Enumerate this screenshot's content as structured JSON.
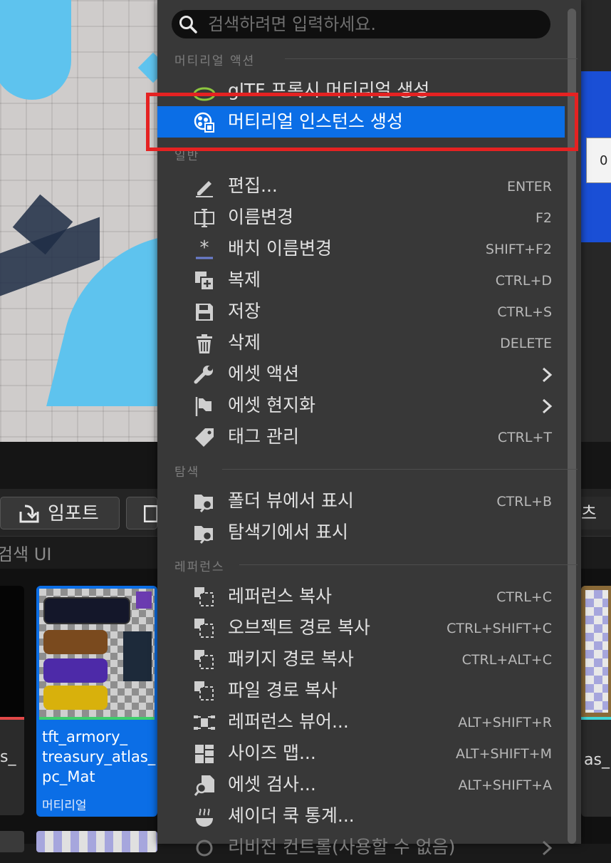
{
  "colors": {
    "menu_bg": "#383838",
    "highlight": "#0b6ee6",
    "annotation_red": "#e52222",
    "viewport_blue": "#5ec3ee"
  },
  "viewport": {
    "popup_text": "0"
  },
  "context_menu": {
    "search": {
      "placeholder": "검색하려면 입력하세요.",
      "icon": "search-icon"
    },
    "sections": {
      "material_actions": "머티리얼 액션",
      "general": "일반",
      "explore": "탐색",
      "references": "레퍼런스"
    },
    "material_items": [
      {
        "label": "glTF 프록시 머티리얼 생성",
        "icon": "gltf-icon"
      },
      {
        "label": "머티리얼 인스턴스 생성",
        "icon": "material-instance-icon",
        "highlighted": true
      }
    ],
    "general_items": [
      {
        "label": "편집...",
        "shortcut": "ENTER",
        "icon": "pencil-icon"
      },
      {
        "label": "이름변경",
        "shortcut": "F2",
        "icon": "rename-icon"
      },
      {
        "label": "배치 이름변경",
        "shortcut": "SHIFT+F2",
        "icon": "batch-rename-icon"
      },
      {
        "label": "복제",
        "shortcut": "CTRL+D",
        "icon": "duplicate-icon"
      },
      {
        "label": "저장",
        "shortcut": "CTRL+S",
        "icon": "save-icon"
      },
      {
        "label": "삭제",
        "shortcut": "DELETE",
        "icon": "trash-icon"
      },
      {
        "label": "에셋 액션",
        "submenu": true,
        "icon": "wrench-icon"
      },
      {
        "label": "에셋 현지화",
        "submenu": true,
        "icon": "flag-icon"
      },
      {
        "label": "태그 관리",
        "shortcut": "CTRL+T",
        "icon": "tag-icon"
      }
    ],
    "explore_items": [
      {
        "label": "폴더 뷰에서 표시",
        "shortcut": "CTRL+B",
        "icon": "folder-search-icon"
      },
      {
        "label": "탐색기에서 표시",
        "icon": "folder-search-icon"
      }
    ],
    "reference_items": [
      {
        "label": "레퍼런스 복사",
        "shortcut": "CTRL+C",
        "icon": "copy-reference-icon"
      },
      {
        "label": "오브젝트 경로 복사",
        "shortcut": "CTRL+SHIFT+C",
        "icon": "copy-reference-icon"
      },
      {
        "label": "패키지 경로 복사",
        "shortcut": "CTRL+ALT+C",
        "icon": "copy-reference-icon"
      },
      {
        "label": "파일 경로 복사",
        "icon": "copy-reference-icon"
      },
      {
        "label": "레퍼런스 뷰어...",
        "shortcut": "ALT+SHIFT+R",
        "icon": "reference-viewer-icon"
      },
      {
        "label": "사이즈 맵...",
        "shortcut": "ALT+SHIFT+M",
        "icon": "size-map-icon"
      },
      {
        "label": "에셋 검사...",
        "shortcut": "ALT+SHIFT+A",
        "icon": "audit-icon"
      },
      {
        "label": "셰이더 쿡 통계...",
        "icon": "shader-cook-icon"
      },
      {
        "label": "리비전 컨트롤(사용할 수 없음)",
        "submenu": true,
        "faded": true,
        "icon": "revision-control-icon"
      }
    ]
  },
  "content_browser": {
    "import_label": "임포트",
    "right_button_label": "츠",
    "search_label": "검색 UI",
    "assets": {
      "left_label": "s_",
      "main": {
        "name": "tft_armory_\ntreasury_atlas_\npc_Mat",
        "type": "머티리얼"
      },
      "right_label": "as_"
    }
  }
}
